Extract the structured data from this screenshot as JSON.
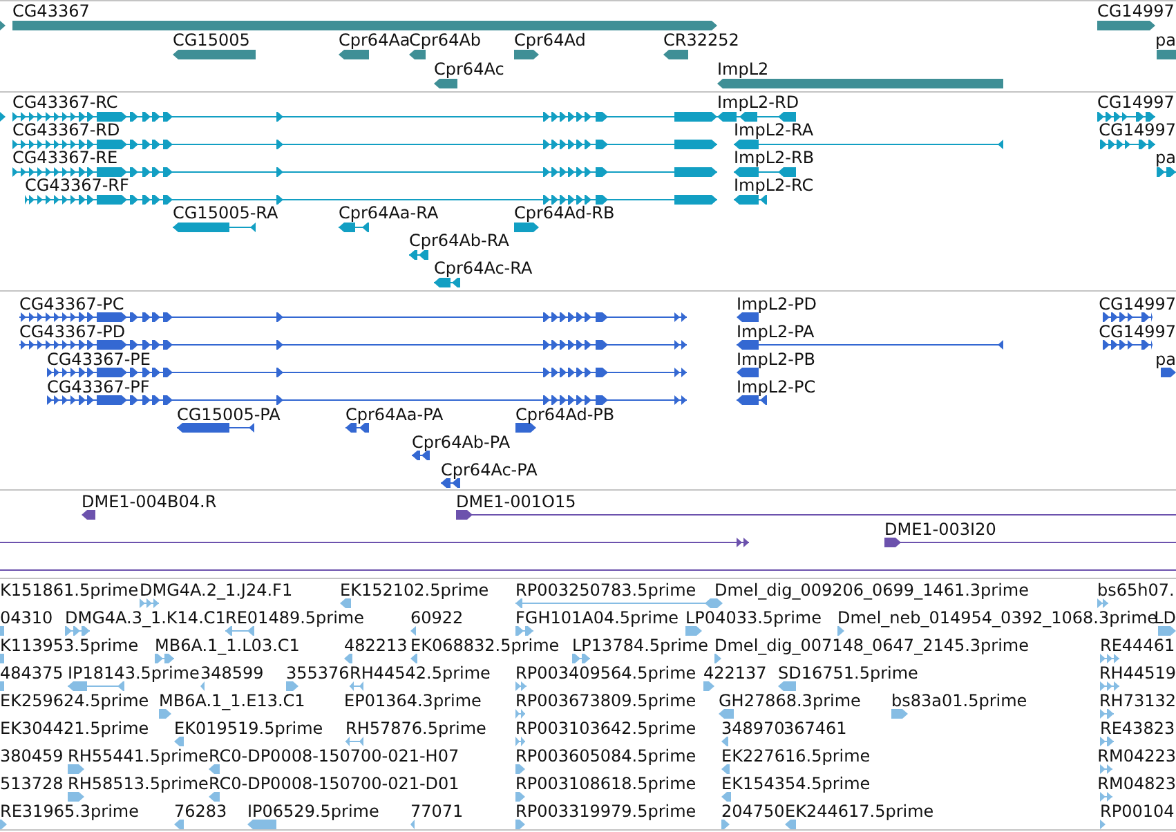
{
  "tracks": [
    {
      "kind": "gene",
      "rows": [
        {
          "features": [
            {
              "reverse": false
            },
            {
              "label": "CG43367",
              "reverse": false
            },
            {
              "label": "CG14997",
              "reverse": false
            }
          ]
        },
        {
          "features": [
            {
              "label": "CG15005",
              "reverse": true
            },
            {
              "label": "Cpr64Aa",
              "reverse": true
            },
            {
              "label": "Cpr64Ab",
              "reverse": true
            },
            {
              "label": "Cpr64Ad",
              "reverse": false
            },
            {
              "label": "CR32252",
              "reverse": true
            },
            {
              "label": "pa"
            }
          ]
        },
        {
          "features": [
            {
              "label": "Cpr64Ac",
              "reverse": true
            },
            {
              "label": "ImpL2",
              "reverse": true
            }
          ]
        }
      ]
    },
    {
      "kind": "transcript",
      "rows": [
        {
          "features": [
            {
              "reverse": false
            },
            {
              "label": "CG43367-RC",
              "reverse": false
            },
            {
              "label": "ImpL2-RD",
              "reverse": true
            },
            {
              "label": "CG14997",
              "reverse": false
            }
          ]
        },
        {
          "features": [
            {
              "label": "CG43367-RD",
              "reverse": false
            },
            {
              "label": "ImpL2-RA",
              "reverse": true
            },
            {
              "label": "CG14997",
              "reverse": false
            }
          ]
        },
        {
          "features": [
            {
              "label": "CG43367-RE",
              "reverse": false
            },
            {
              "label": "ImpL2-RB",
              "reverse": true
            },
            {
              "label": "pa",
              "reverse": false
            }
          ]
        },
        {
          "features": [
            {
              "label": "CG43367-RF",
              "reverse": false
            },
            {
              "label": "ImpL2-RC",
              "reverse": true
            }
          ]
        },
        {
          "features": [
            {
              "label": "CG15005-RA",
              "reverse": true
            },
            {
              "label": "Cpr64Aa-RA",
              "reverse": true
            },
            {
              "label": "Cpr64Ad-RB",
              "reverse": false
            }
          ]
        },
        {
          "features": [
            {
              "label": "Cpr64Ab-RA",
              "reverse": true
            }
          ]
        },
        {
          "features": [
            {
              "label": "Cpr64Ac-RA",
              "reverse": true
            }
          ]
        }
      ]
    },
    {
      "kind": "protein",
      "rows": [
        {
          "features": [
            {
              "label": "CG43367-PC",
              "reverse": false
            },
            {
              "label": "ImpL2-PD",
              "reverse": true
            },
            {
              "label": "CG14997",
              "reverse": false
            }
          ]
        },
        {
          "features": [
            {
              "label": "CG43367-PD",
              "reverse": false
            },
            {
              "label": "ImpL2-PA",
              "reverse": true
            },
            {
              "label": "CG14997",
              "reverse": false
            }
          ]
        },
        {
          "features": [
            {
              "label": "CG43367-PE",
              "reverse": false
            },
            {
              "label": "ImpL2-PB",
              "reverse": true
            },
            {
              "label": "pa",
              "reverse": false
            }
          ]
        },
        {
          "features": [
            {
              "label": "CG43367-PF",
              "reverse": false
            },
            {
              "label": "ImpL2-PC",
              "reverse": true
            }
          ]
        },
        {
          "features": [
            {
              "label": "CG15005-PA",
              "reverse": true
            },
            {
              "label": "Cpr64Aa-PA",
              "reverse": true
            },
            {
              "label": "Cpr64Ad-PB",
              "reverse": false
            }
          ]
        },
        {
          "features": [
            {
              "label": "Cpr64Ab-PA",
              "reverse": true
            }
          ]
        },
        {
          "features": [
            {
              "label": "Cpr64Ac-PA",
              "reverse": true
            }
          ]
        }
      ]
    },
    {
      "kind": "clone",
      "rows": [
        {
          "features": [
            {
              "label": "DME1-004B04.R",
              "reverse": true
            },
            {
              "label": "DME1-001O15",
              "reverse": false
            }
          ]
        },
        {
          "features": [
            {
              "reverse": false
            },
            {
              "label": "DME1-003I20",
              "reverse": false
            }
          ]
        }
      ]
    },
    {
      "kind": "est",
      "rows": [
        {
          "features": [
            {
              "label": "K151861.5prime"
            },
            {
              "label": "DMG4A.2_1.J24.F1",
              "reverse": false
            },
            {
              "label": "EK152102.5prime",
              "reverse": true
            },
            {
              "label": "RP003250783.5prime",
              "reverse": true
            },
            {
              "label": "Dmel_dig_009206_0699_1461.3prime",
              "reverse": false
            },
            {
              "label": "bs65h07.",
              "reverse": false
            }
          ]
        },
        {
          "features": [
            {
              "label": "04310"
            },
            {
              "label": "DMG4A.3_1.K14.C1",
              "reverse": false
            },
            {
              "label": "RE01489.5prime",
              "reverse": true
            },
            {
              "label": "60922",
              "reverse": true
            },
            {
              "label": "FGH101A04.5prime",
              "reverse": false
            },
            {
              "label": "LP04033.5prime",
              "reverse": false
            },
            {
              "label": "Dmel_neb_014954_0392_1068.3prime",
              "reverse": false
            },
            {
              "label": "LD",
              "reverse": false
            }
          ]
        },
        {
          "features": [
            {
              "label": "K113953.5prime"
            },
            {
              "label": "MB6A.1_1.L03.C1",
              "reverse": false
            },
            {
              "label": "482213",
              "reverse": true
            },
            {
              "label": "EK068832.5prime",
              "reverse": true
            },
            {
              "label": "LP13784.5prime",
              "reverse": false
            },
            {
              "label": "Dmel_dig_007148_0647_2145.3prime",
              "reverse": false
            },
            {
              "label": "RE44461",
              "reverse": false
            }
          ]
        },
        {
          "features": [
            {
              "label": "484375"
            },
            {
              "label": "IP18143.5prime",
              "reverse": true
            },
            {
              "label": "348599",
              "reverse": true
            },
            {
              "label": "355376",
              "reverse": false
            },
            {
              "label": "RH44542.5prime",
              "reverse": true
            },
            {
              "label": "RP003409564.5prime",
              "reverse": false
            },
            {
              "label": "422137",
              "reverse": false
            },
            {
              "label": "SD16751.5prime",
              "reverse": true
            },
            {
              "label": "RH44519",
              "reverse": false
            }
          ]
        },
        {
          "features": [
            {
              "label": "EK259624.5prime"
            },
            {
              "label": "MB6A.1_1.E13.C1",
              "reverse": false
            },
            {
              "label": "EP01364.3prime"
            },
            {
              "label": "RP003673809.5prime",
              "reverse": false
            },
            {
              "label": "GH27868.3prime",
              "reverse": true
            },
            {
              "label": "bs83a01.5prime",
              "reverse": false
            },
            {
              "label": "RH73132",
              "reverse": false
            }
          ]
        },
        {
          "features": [
            {
              "label": "EK304421.5prime"
            },
            {
              "label": "EK019519.5prime",
              "reverse": true
            },
            {
              "label": "RH57876.5prime",
              "reverse": true
            },
            {
              "label": "RP003103642.5prime",
              "reverse": false
            },
            {
              "label": "348970",
              "reverse": true
            },
            {
              "label": "367461"
            },
            {
              "label": "RE43823",
              "reverse": false
            }
          ]
        },
        {
          "features": [
            {
              "label": "380459"
            },
            {
              "label": "RH55441.5prime",
              "reverse": false
            },
            {
              "label": "RC0-DP0008-150700-021-H07",
              "reverse": true
            },
            {
              "label": "RP003605084.5prime",
              "reverse": false
            },
            {
              "label": "EK227616.5prime",
              "reverse": true
            },
            {
              "label": "RM04223",
              "reverse": false
            }
          ]
        },
        {
          "features": [
            {
              "label": "513728"
            },
            {
              "label": "RH58513.5prime",
              "reverse": false
            },
            {
              "label": "RC0-DP0008-150700-021-D01",
              "reverse": true
            },
            {
              "label": "RP003108618.5prime",
              "reverse": false
            },
            {
              "label": "EK154354.5prime",
              "reverse": true
            },
            {
              "label": "RM04823",
              "reverse": false
            }
          ]
        },
        {
          "features": [
            {
              "label": "RE31965.3prime",
              "reverse": false
            },
            {
              "label": "76283",
              "reverse": true
            },
            {
              "label": "IP06529.5prime",
              "reverse": true
            },
            {
              "label": "77071",
              "reverse": true
            },
            {
              "label": "RP003319979.5prime",
              "reverse": false
            },
            {
              "label": "204750",
              "reverse": false
            },
            {
              "label": "EK244617.5prime",
              "reverse": true
            },
            {
              "label": "RP00104",
              "reverse": false
            }
          ]
        }
      ]
    }
  ]
}
